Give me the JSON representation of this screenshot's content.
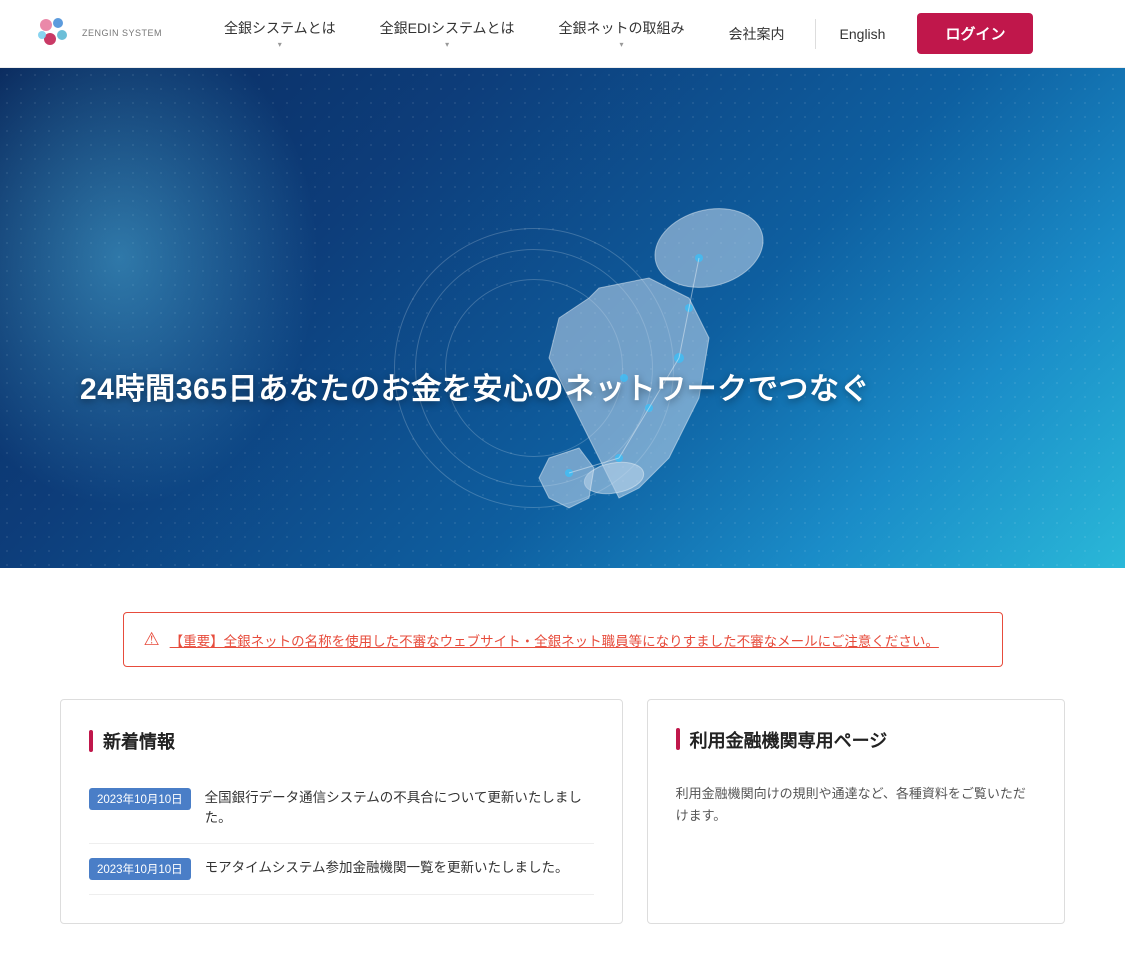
{
  "header": {
    "logo_text": "ZENGIN\nSYSTEM",
    "nav_items": [
      {
        "label": "全銀システムとは",
        "has_chevron": true
      },
      {
        "label": "全銀EDIシステムとは",
        "has_chevron": true
      },
      {
        "label": "全銀ネットの取組み",
        "has_chevron": true
      },
      {
        "label": "会社案内",
        "has_chevron": false
      }
    ],
    "english_label": "English",
    "login_label": "ログイン"
  },
  "hero": {
    "title": "24時間365日あなたのお金を安心のネットワークでつなぐ"
  },
  "alert": {
    "text": "【重要】全銀ネットの名称を使用した不審なウェブサイト・全銀ネット職員等になりすました不審なメールにご注意ください。"
  },
  "news": {
    "section_title": "新着情報",
    "items": [
      {
        "date": "2023年10月10日",
        "text": "全国銀行データ通信システムの不具合について更新いたしました。"
      },
      {
        "date": "2023年10月10日",
        "text": "モアタイムシステム参加金融機関一覧を更新いたしました。"
      }
    ]
  },
  "info_card": {
    "title": "利用金融機関専用ページ",
    "description": "利用金融機関向けの規則や通達など、各種資料をご覧いただけます。"
  }
}
